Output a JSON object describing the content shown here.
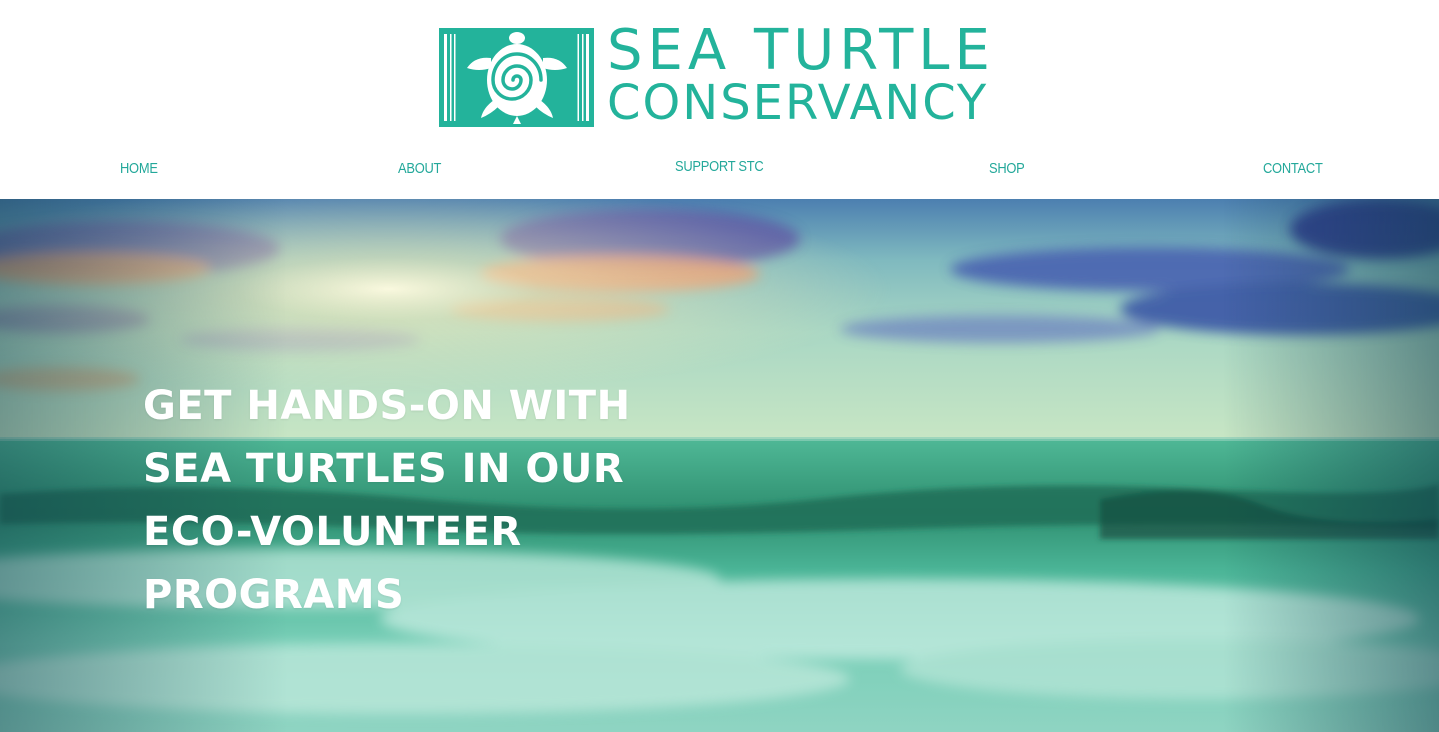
{
  "brand": {
    "name_line1": "SEA TURTLE",
    "name_line2": "CONSERVANCY",
    "color": "#23b39b",
    "logo_icon": "sea-turtle-logo-icon"
  },
  "nav": {
    "items": [
      {
        "label": "HOME"
      },
      {
        "label": "ABOUT"
      },
      {
        "label": "SUPPORT STC"
      },
      {
        "label": "SHOP"
      },
      {
        "label": "CONTACT"
      }
    ],
    "color": "#23a89a"
  },
  "hero": {
    "headline_lines": [
      "GET HANDS-ON WITH",
      "SEA TURTLES IN OUR",
      "ECO-VOLUNTEER",
      "PROGRAMS"
    ],
    "text_color": "#ffffff",
    "image": "ocean-sunset-hero-image"
  }
}
